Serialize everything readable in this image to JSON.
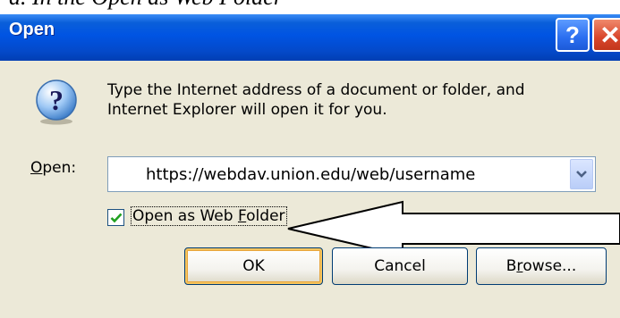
{
  "document": {
    "text": "a. In the Open as Web Folder"
  },
  "window": {
    "title": "Open",
    "help_symbol": "?",
    "close_symbol": "✕"
  },
  "message": {
    "line1": "Type the Internet address of a document or folder, and",
    "line2": "Internet Explorer will open it for you."
  },
  "open_field": {
    "label_mnemonic": "O",
    "label_rest": "pen:",
    "value": "https://webdav.union.edu/web/username"
  },
  "web_folder_checkbox": {
    "checked": true,
    "label_pre": "Open as Web ",
    "label_mnemonic": "F",
    "label_post": "older"
  },
  "buttons": {
    "ok": "OK",
    "cancel": "Cancel",
    "browse_pre": "B",
    "browse_mnemonic": "r",
    "browse_post": "owse..."
  },
  "icons": {
    "dialog": "question-icon",
    "title_help": "help-icon",
    "title_close": "close-icon",
    "dropdown": "chevron-down-icon",
    "annotation": "pointer-arrow-icon"
  },
  "colors": {
    "titlebar": "#0054e3",
    "dialog_bg": "#ece9d8",
    "close_button": "#d8452b",
    "default_button_focus": "#f5c45d"
  }
}
